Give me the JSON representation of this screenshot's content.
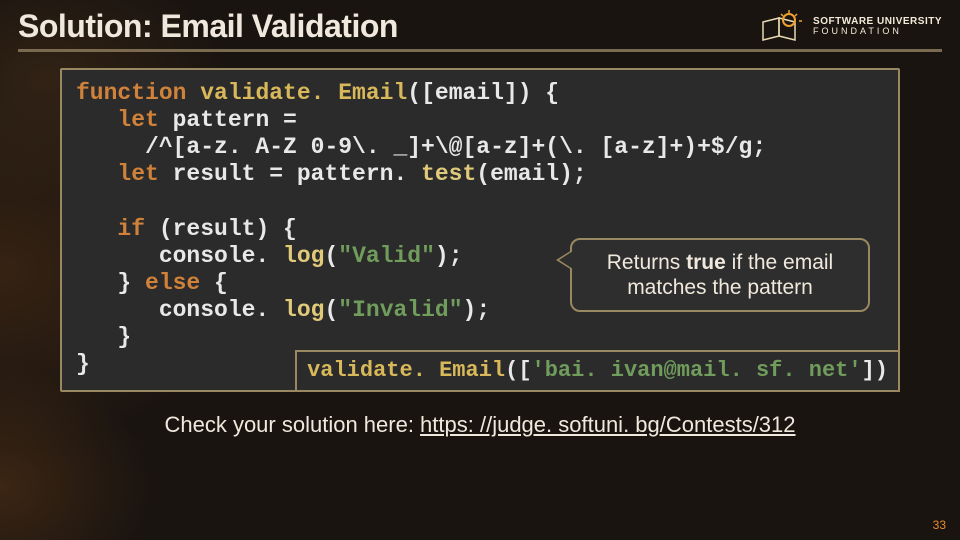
{
  "header": {
    "title": "Solution: Email Validation",
    "logo": {
      "top": "SOFTWARE UNIVERSITY",
      "bottom": "FOUNDATION"
    }
  },
  "code": {
    "l1a": "function ",
    "l1b": "validate. Email",
    "l1c": "([email]) {",
    "l2a": "   let ",
    "l2b": "pattern = ",
    "l3": "     /^[a-z. A-Z 0-9\\. _]+\\@[a-z]+(\\. [a-z]+)+$/g",
    "l3b": ";",
    "l4a": "   let ",
    "l4b": "result = pattern. ",
    "l4c": "test",
    "l4d": "(email);",
    "l5a": "   if ",
    "l5b": "(result) {",
    "l6a": "      console. ",
    "l6b": "log",
    "l6c": "(",
    "l6d": "\"Valid\"",
    "l6e": ");",
    "l7a": "   } ",
    "l7b": "else ",
    "l7c": "{",
    "l8a": "      console. ",
    "l8b": "log",
    "l8c": "(",
    "l8d": "\"Invalid\"",
    "l8e": ");",
    "l9": "   }",
    "l10": "}"
  },
  "callout": {
    "pre": "Returns ",
    "bold": "true",
    "post": " if the email matches the pattern"
  },
  "call": {
    "fn": "validate. Email",
    "a": "([",
    "s": "'bai. ivan@mail. sf. net'",
    "b": "])"
  },
  "check": {
    "text": "Check your solution here: ",
    "url_label": "https: //judge. softuni. bg/Contests/312"
  },
  "page": "33"
}
